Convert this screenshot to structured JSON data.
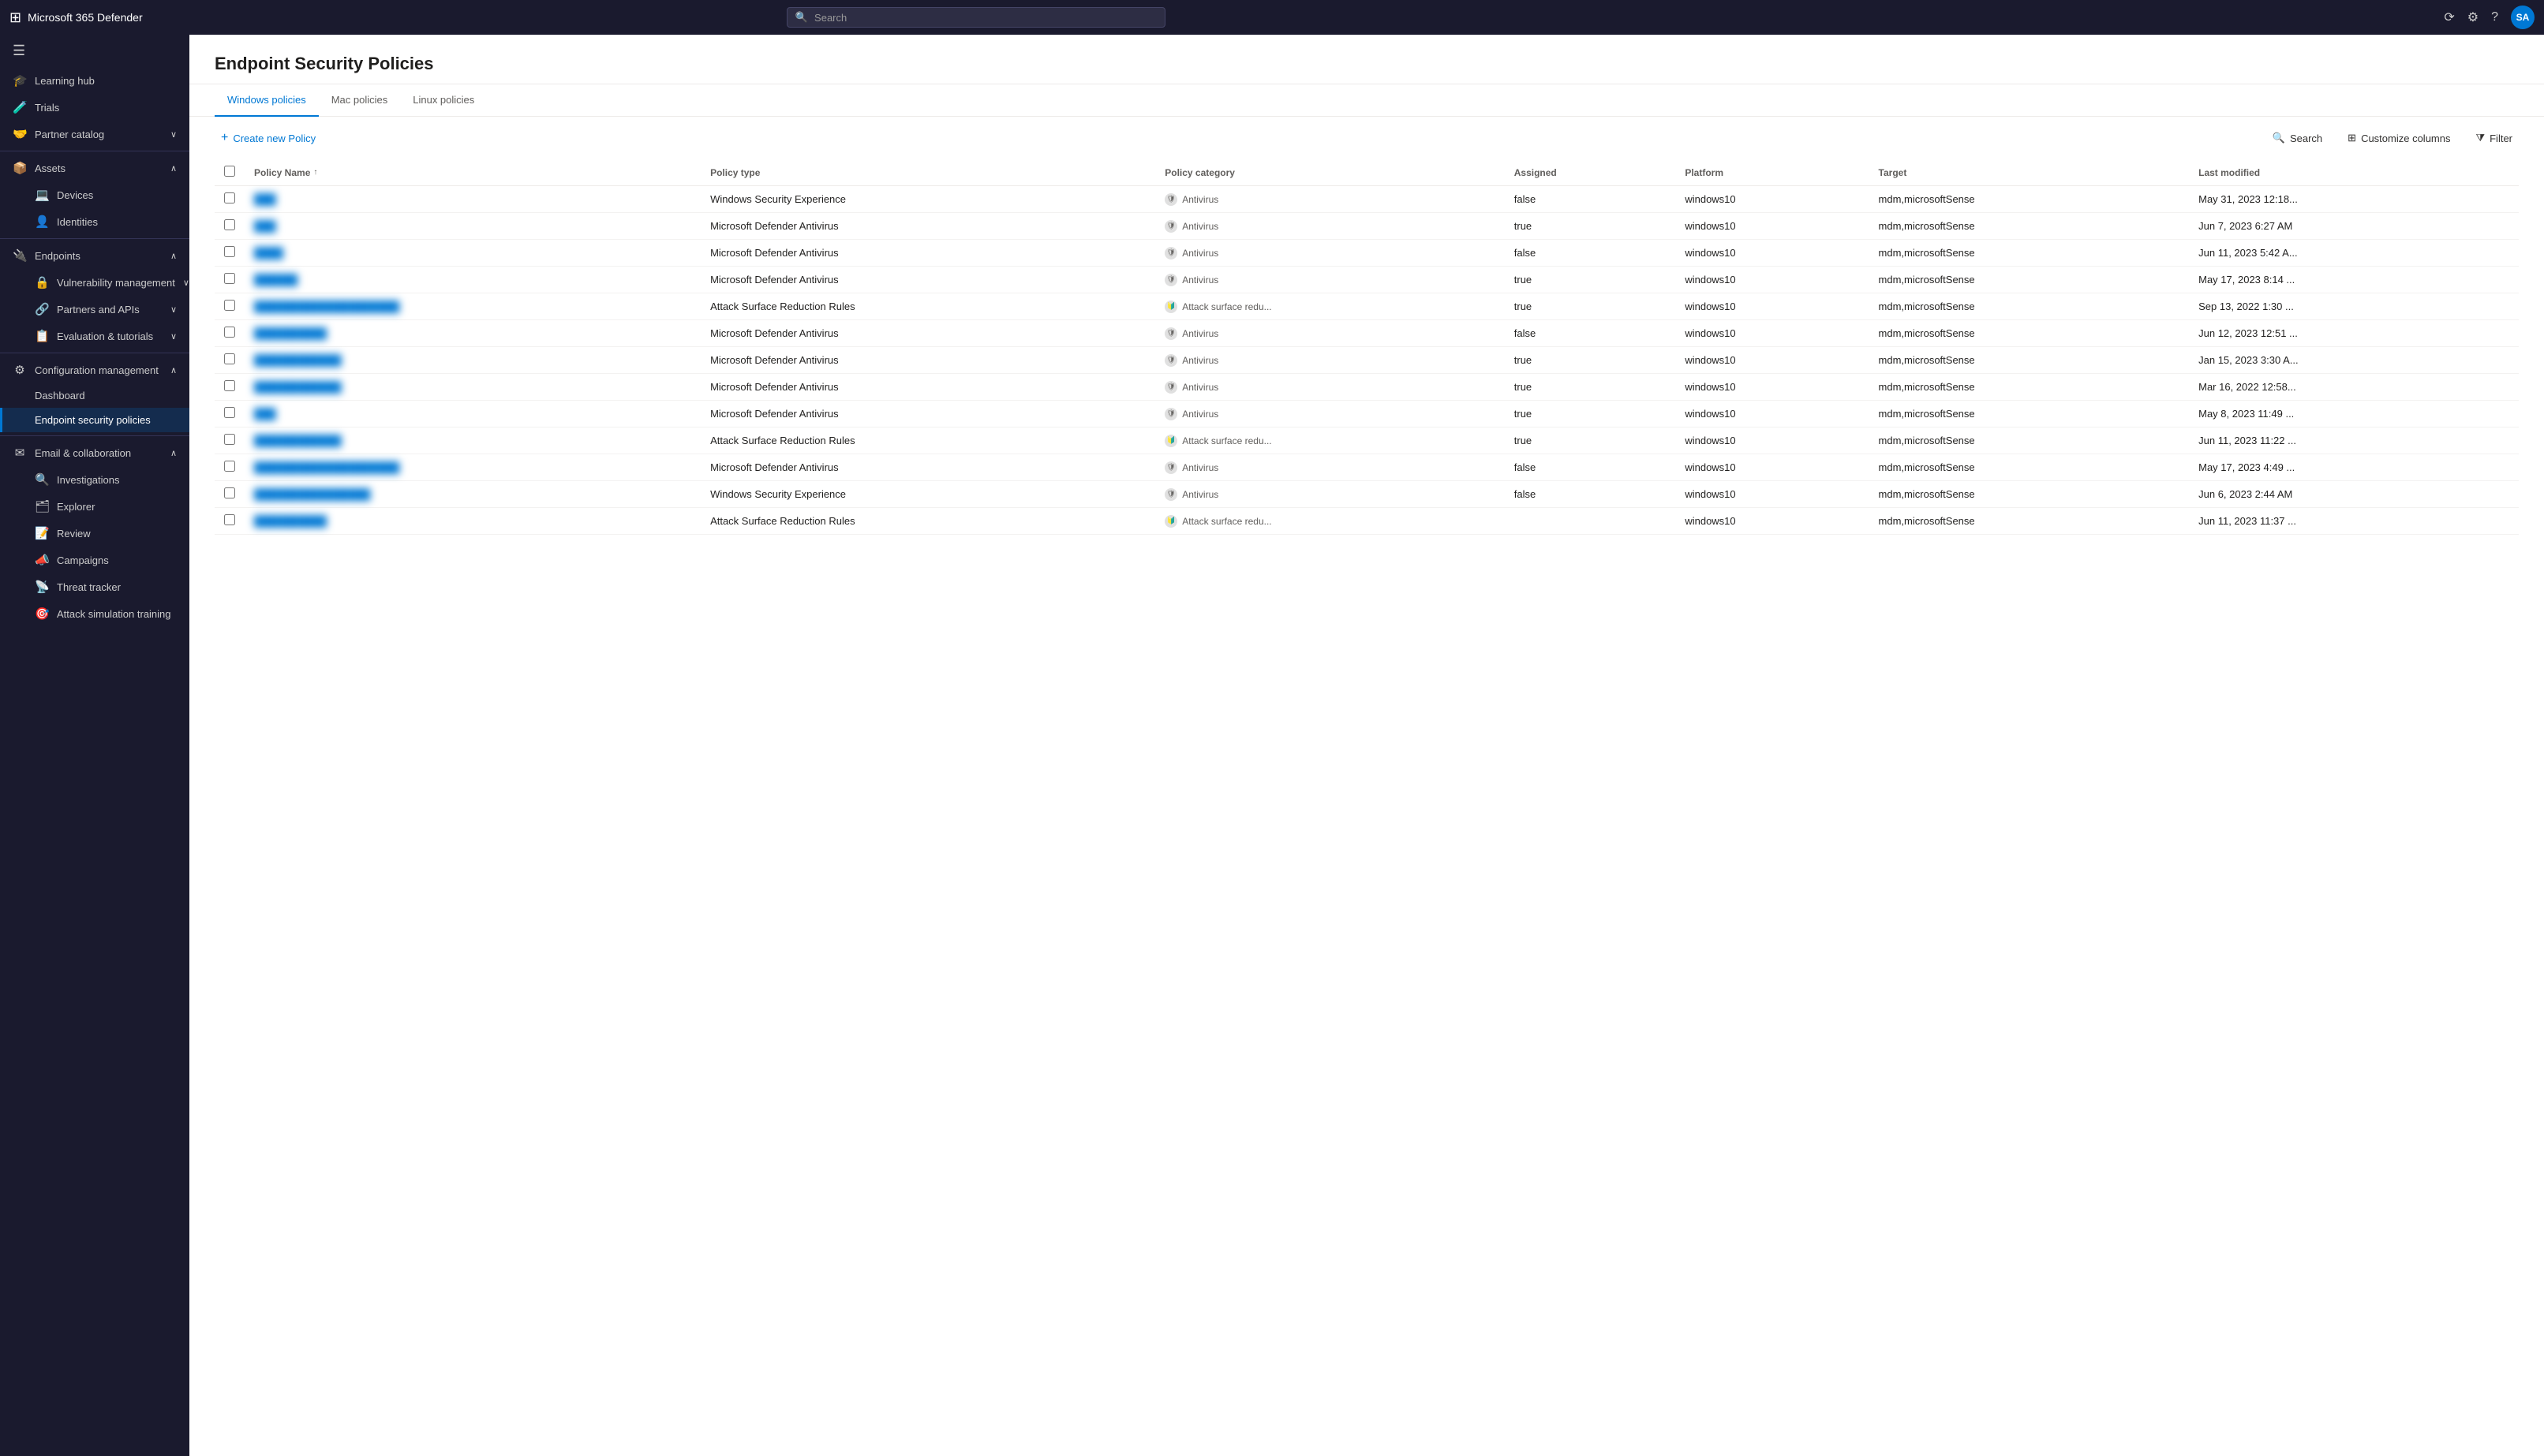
{
  "app": {
    "brand": "Microsoft 365 Defender",
    "search_placeholder": "Search",
    "avatar_initials": "SA"
  },
  "topbar": {
    "search_label": "Search",
    "icons": {
      "waffle": "⊞",
      "share": "🔗",
      "settings": "⚙",
      "help": "?"
    }
  },
  "sidebar": {
    "hamburger": "☰",
    "items": [
      {
        "id": "learning-hub",
        "label": "Learning hub",
        "icon": "🎓",
        "indent": false,
        "expandable": false
      },
      {
        "id": "trials",
        "label": "Trials",
        "icon": "🧪",
        "indent": false,
        "expandable": false
      },
      {
        "id": "partner-catalog",
        "label": "Partner catalog",
        "icon": "🤝",
        "indent": false,
        "expandable": true
      },
      {
        "id": "assets",
        "label": "Assets",
        "icon": "📦",
        "indent": false,
        "expandable": true,
        "section": true
      },
      {
        "id": "devices",
        "label": "Devices",
        "icon": "💻",
        "indent": true,
        "expandable": false
      },
      {
        "id": "identities",
        "label": "Identities",
        "icon": "👤",
        "indent": true,
        "expandable": false
      },
      {
        "id": "endpoints",
        "label": "Endpoints",
        "icon": "🔌",
        "indent": false,
        "expandable": true,
        "section": true
      },
      {
        "id": "vulnerability-management",
        "label": "Vulnerability management",
        "icon": "🔒",
        "indent": true,
        "expandable": true
      },
      {
        "id": "partners-and-apis",
        "label": "Partners and APIs",
        "icon": "🔗",
        "indent": true,
        "expandable": true
      },
      {
        "id": "evaluation-tutorials",
        "label": "Evaluation & tutorials",
        "icon": "📋",
        "indent": true,
        "expandable": true
      },
      {
        "id": "configuration-management",
        "label": "Configuration management",
        "icon": "⚙",
        "indent": false,
        "expandable": true,
        "section": true
      },
      {
        "id": "dashboard",
        "label": "Dashboard",
        "icon": "",
        "indent": true,
        "expandable": false
      },
      {
        "id": "endpoint-security-policies",
        "label": "Endpoint security policies",
        "icon": "",
        "indent": true,
        "expandable": false,
        "active": true
      },
      {
        "id": "email-collaboration",
        "label": "Email & collaboration",
        "icon": "✉",
        "indent": false,
        "expandable": true,
        "section": true
      },
      {
        "id": "investigations",
        "label": "Investigations",
        "icon": "🔍",
        "indent": true,
        "expandable": false
      },
      {
        "id": "explorer",
        "label": "Explorer",
        "icon": "🗂",
        "indent": true,
        "expandable": false
      },
      {
        "id": "review",
        "label": "Review",
        "icon": "📝",
        "indent": true,
        "expandable": false
      },
      {
        "id": "campaigns",
        "label": "Campaigns",
        "icon": "📣",
        "indent": true,
        "expandable": false
      },
      {
        "id": "threat-tracker",
        "label": "Threat tracker",
        "icon": "📡",
        "indent": true,
        "expandable": false
      },
      {
        "id": "attack-simulation",
        "label": "Attack simulation training",
        "icon": "🎯",
        "indent": true,
        "expandable": false
      }
    ]
  },
  "page": {
    "title": "Endpoint Security Policies",
    "tabs": [
      {
        "id": "windows",
        "label": "Windows policies",
        "active": true
      },
      {
        "id": "mac",
        "label": "Mac policies",
        "active": false
      },
      {
        "id": "linux",
        "label": "Linux policies",
        "active": false
      }
    ],
    "toolbar": {
      "create_btn": "Create new Policy",
      "search_btn": "Search",
      "customize_btn": "Customize columns",
      "filter_btn": "Filter"
    },
    "table": {
      "columns": [
        {
          "id": "name",
          "label": "Policy Name",
          "sortable": true
        },
        {
          "id": "type",
          "label": "Policy type",
          "sortable": false
        },
        {
          "id": "category",
          "label": "Policy category",
          "sortable": false
        },
        {
          "id": "assigned",
          "label": "Assigned",
          "sortable": false
        },
        {
          "id": "platform",
          "label": "Platform",
          "sortable": false
        },
        {
          "id": "target",
          "label": "Target",
          "sortable": false
        },
        {
          "id": "last_modified",
          "label": "Last modified",
          "sortable": false
        }
      ],
      "rows": [
        {
          "name": "███",
          "blurred": true,
          "type": "Windows Security Experience",
          "category": "Antivirus",
          "category_type": "antivirus",
          "assigned": "false",
          "platform": "windows10",
          "target": "mdm,microsoftSense",
          "last_modified": "May 31, 2023 12:18..."
        },
        {
          "name": "███",
          "blurred": true,
          "type": "Microsoft Defender Antivirus",
          "category": "Antivirus",
          "category_type": "antivirus",
          "assigned": "true",
          "platform": "windows10",
          "target": "mdm,microsoftSense",
          "last_modified": "Jun 7, 2023 6:27 AM"
        },
        {
          "name": "████",
          "blurred": true,
          "type": "Microsoft Defender Antivirus",
          "category": "Antivirus",
          "category_type": "antivirus",
          "assigned": "false",
          "platform": "windows10",
          "target": "mdm,microsoftSense",
          "last_modified": "Jun 11, 2023 5:42 A..."
        },
        {
          "name": "██████",
          "blurred": true,
          "type": "Microsoft Defender Antivirus",
          "category": "Antivirus",
          "category_type": "antivirus",
          "assigned": "true",
          "platform": "windows10",
          "target": "mdm,microsoftSense",
          "last_modified": "May 17, 2023 8:14 ..."
        },
        {
          "name": "████████████████████",
          "blurred": true,
          "type": "Attack Surface Reduction Rules",
          "category": "Attack surface redu...",
          "category_type": "attack",
          "assigned": "true",
          "platform": "windows10",
          "target": "mdm,microsoftSense",
          "last_modified": "Sep 13, 2022 1:30 ..."
        },
        {
          "name": "██████████",
          "blurred": true,
          "type": "Microsoft Defender Antivirus",
          "category": "Antivirus",
          "category_type": "antivirus",
          "assigned": "false",
          "platform": "windows10",
          "target": "mdm,microsoftSense",
          "last_modified": "Jun 12, 2023 12:51 ..."
        },
        {
          "name": "████████████",
          "blurred": true,
          "type": "Microsoft Defender Antivirus",
          "category": "Antivirus",
          "category_type": "antivirus",
          "assigned": "true",
          "platform": "windows10",
          "target": "mdm,microsoftSense",
          "last_modified": "Jan 15, 2023 3:30 A..."
        },
        {
          "name": "████████████",
          "blurred": true,
          "type": "Microsoft Defender Antivirus",
          "category": "Antivirus",
          "category_type": "antivirus",
          "assigned": "true",
          "platform": "windows10",
          "target": "mdm,microsoftSense",
          "last_modified": "Mar 16, 2022 12:58..."
        },
        {
          "name": "███",
          "blurred": true,
          "type": "Microsoft Defender Antivirus",
          "category": "Antivirus",
          "category_type": "antivirus",
          "assigned": "true",
          "platform": "windows10",
          "target": "mdm,microsoftSense",
          "last_modified": "May 8, 2023 11:49 ..."
        },
        {
          "name": "████████████",
          "blurred": true,
          "type": "Attack Surface Reduction Rules",
          "category": "Attack surface redu...",
          "category_type": "attack",
          "assigned": "true",
          "platform": "windows10",
          "target": "mdm,microsoftSense",
          "last_modified": "Jun 11, 2023 11:22 ..."
        },
        {
          "name": "████████████████████",
          "blurred": true,
          "type": "Microsoft Defender Antivirus",
          "category": "Antivirus",
          "category_type": "antivirus",
          "assigned": "false",
          "platform": "windows10",
          "target": "mdm,microsoftSense",
          "last_modified": "May 17, 2023 4:49 ..."
        },
        {
          "name": "████████████████",
          "blurred": true,
          "type": "Windows Security Experience",
          "category": "Antivirus",
          "category_type": "antivirus",
          "assigned": "false",
          "platform": "windows10",
          "target": "mdm,microsoftSense",
          "last_modified": "Jun 6, 2023 2:44 AM"
        },
        {
          "name": "██████████",
          "blurred": true,
          "type": "Attack Surface Reduction Rules",
          "category": "Attack surface redu...",
          "category_type": "attack",
          "assigned": "",
          "platform": "windows10",
          "target": "mdm,microsoftSense",
          "last_modified": "Jun 11, 2023 11:37 ..."
        }
      ]
    }
  }
}
